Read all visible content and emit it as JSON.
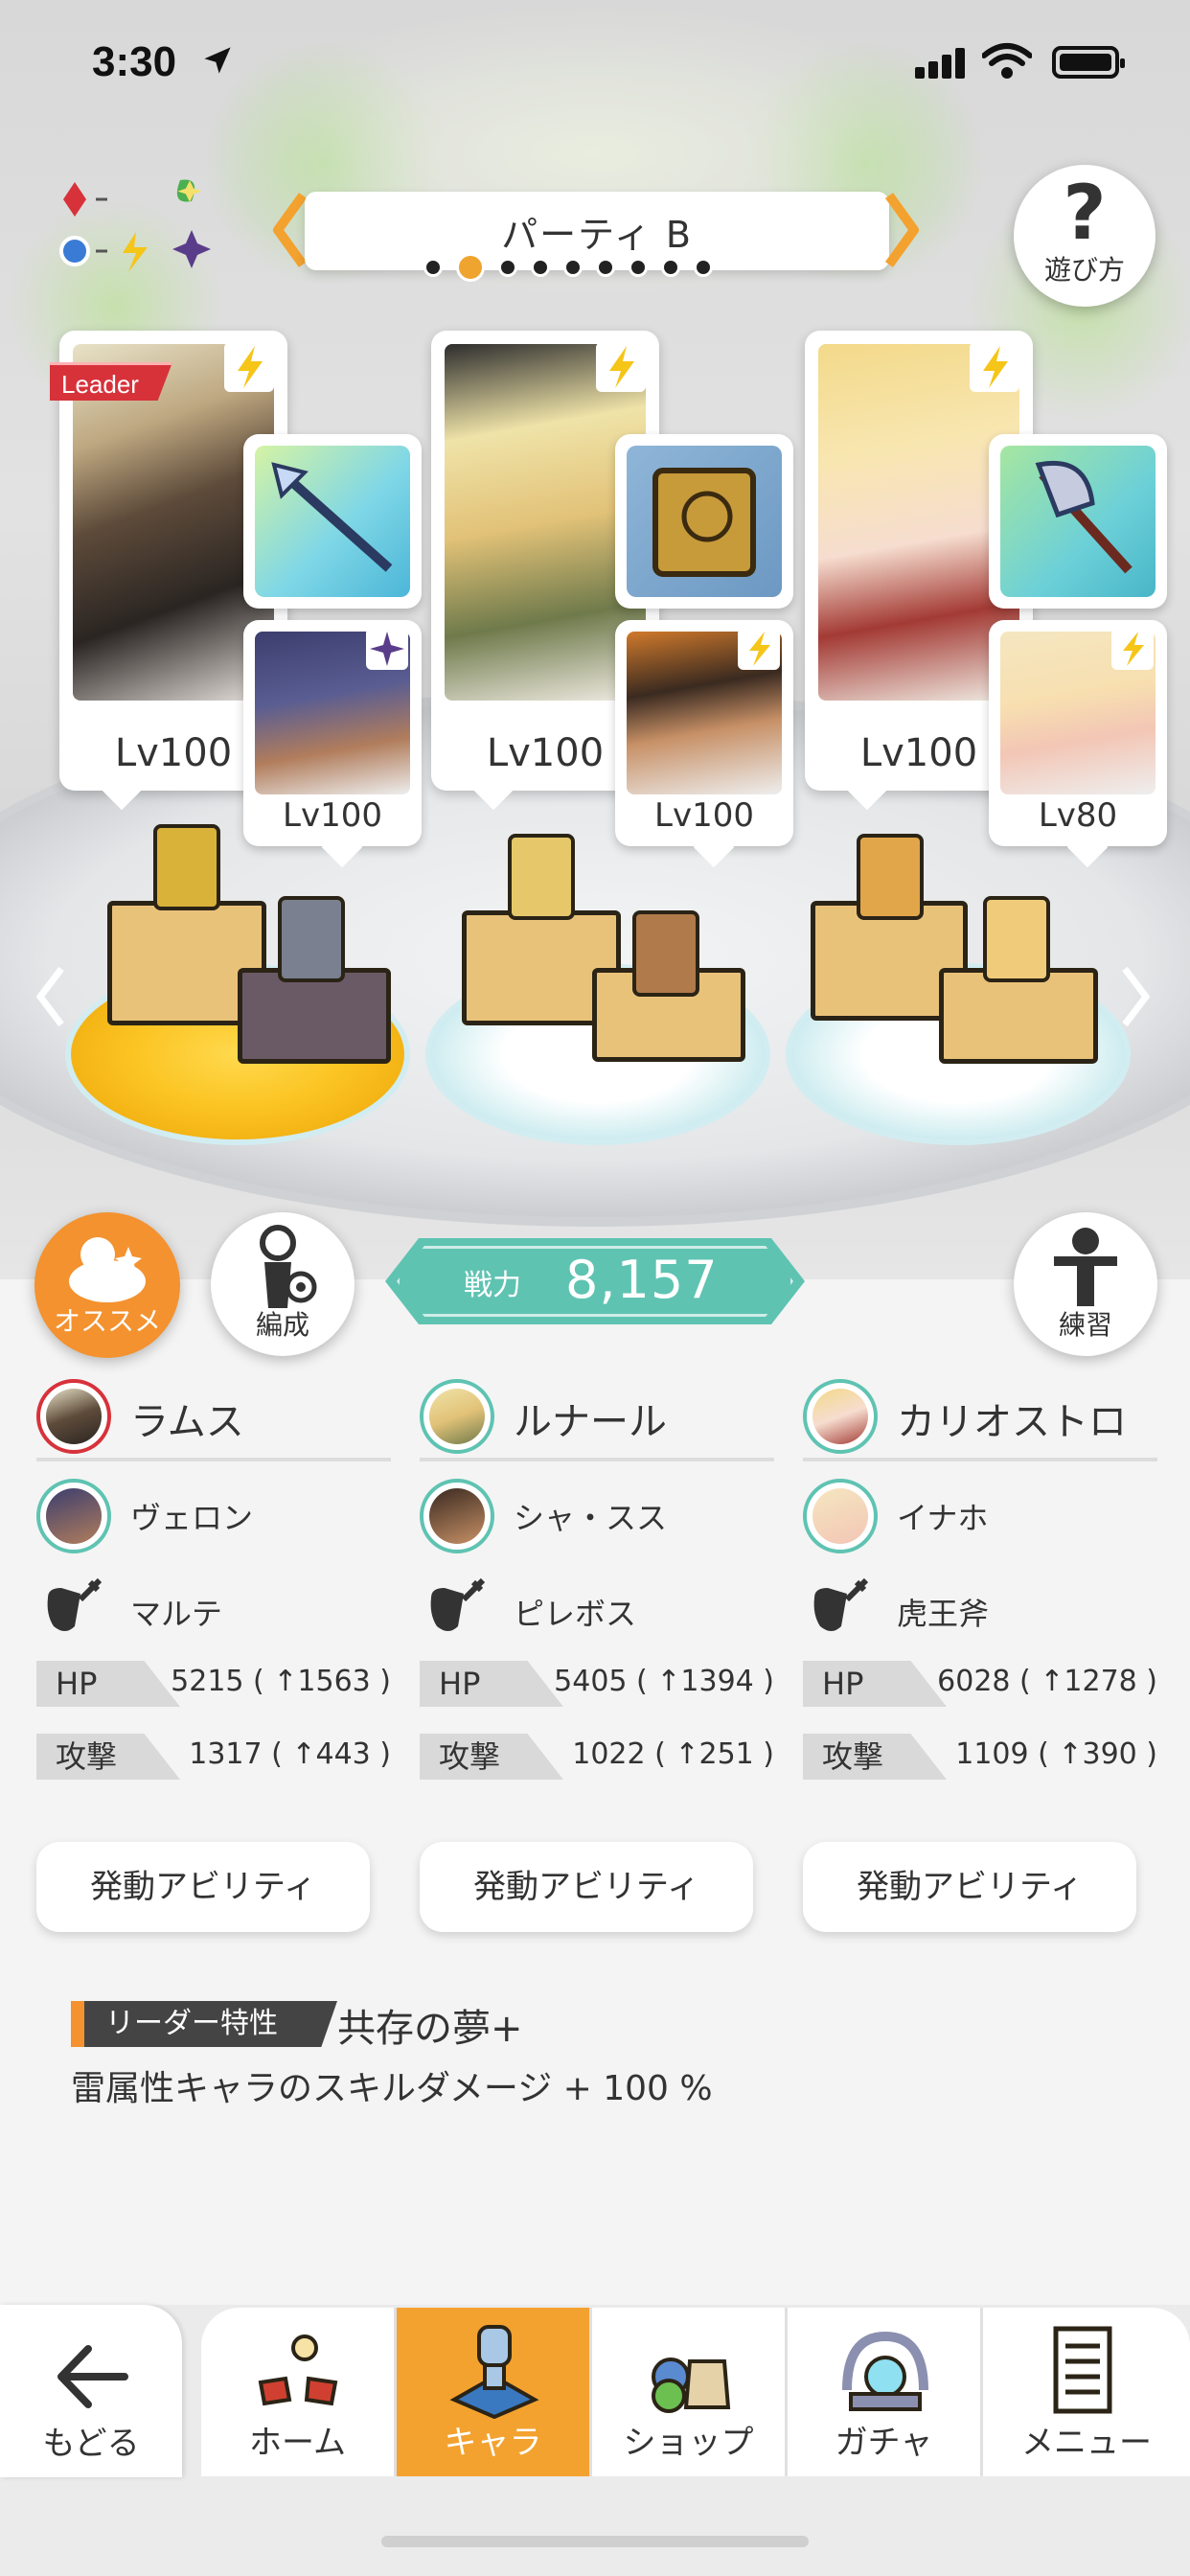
{
  "status_bar": {
    "time": "3:30"
  },
  "party": {
    "name": "パーティ B",
    "page_count": 9,
    "active_page": 2
  },
  "help": {
    "label": "遊び方"
  },
  "leader_tag": "Leader",
  "characters": [
    {
      "main_level": "Lv100",
      "sub_level": "Lv100"
    },
    {
      "main_level": "Lv100",
      "sub_level": "Lv100"
    },
    {
      "main_level": "Lv100",
      "sub_level": "Lv80"
    }
  ],
  "buttons": {
    "recommend": "オススメ",
    "formation": "編成",
    "practice": "練習"
  },
  "power": {
    "label": "戦力",
    "value": "8,157"
  },
  "columns": [
    {
      "main_name": "ラムス",
      "sub_name": "ヴェロン",
      "weapon_name": "マルテ",
      "hp_label": "HP",
      "hp_value": "5215 ( ↑1563 )",
      "atk_label": "攻撃",
      "atk_value": "1317 ( ↑443 )",
      "ability_label": "発動アビリティ"
    },
    {
      "main_name": "ルナール",
      "sub_name": "シャ・スス",
      "weapon_name": "ピレボス",
      "hp_label": "HP",
      "hp_value": "5405 ( ↑1394 )",
      "atk_label": "攻撃",
      "atk_value": "1022 ( ↑251 )",
      "ability_label": "発動アビリティ"
    },
    {
      "main_name": "カリオストロ",
      "sub_name": "イナホ",
      "weapon_name": "虎王斧",
      "hp_label": "HP",
      "hp_value": "6028 ( ↑1278 )",
      "atk_label": "攻撃",
      "atk_value": "1109 ( ↑390 )",
      "ability_label": "発動アビリティ"
    }
  ],
  "leader_trait": {
    "label": "リーダー特性",
    "name": "共存の夢+",
    "description": "雷属性キャラのスキルダメージ + 100 %"
  },
  "nav": {
    "back": "もどる",
    "tabs": [
      "ホーム",
      "キャラ",
      "ショップ",
      "ガチャ",
      "メニュー"
    ],
    "active_tab": "キャラ"
  },
  "colors": {
    "accent_orange": "#f3a22f",
    "power_teal": "#5fc3b2",
    "leader_red": "#d7323a",
    "thunder_yellow": "#f5c518"
  }
}
